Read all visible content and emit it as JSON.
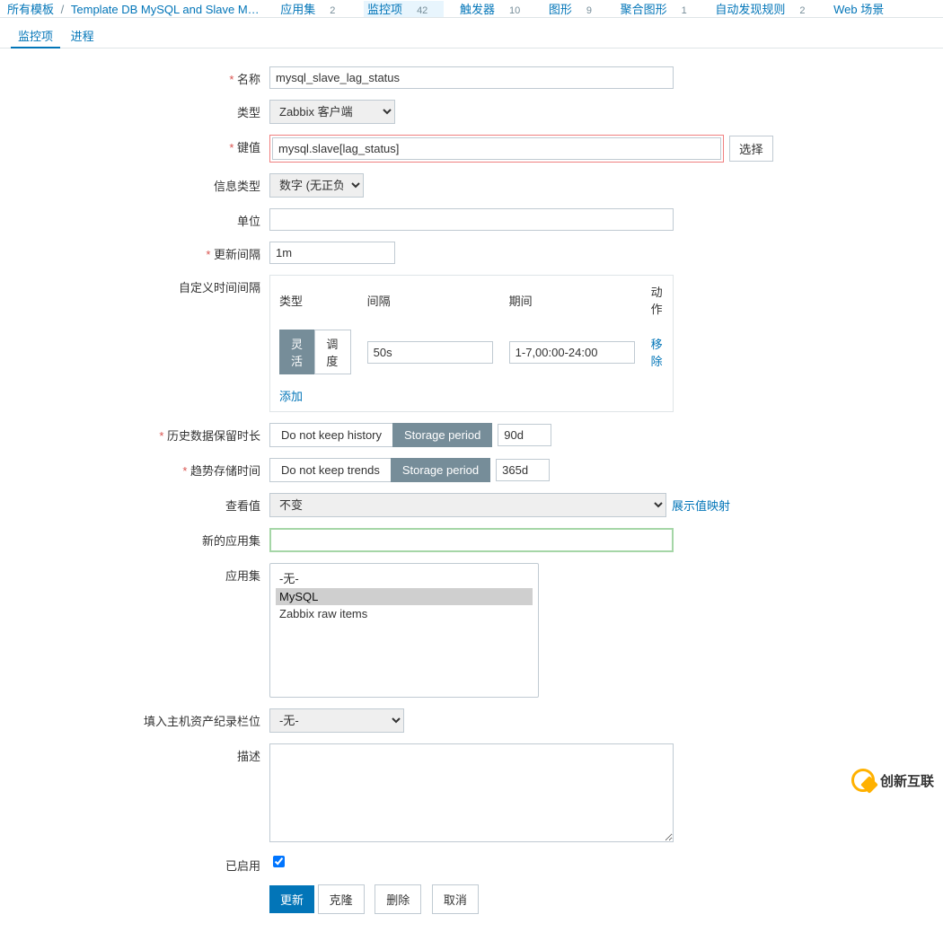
{
  "breadcrumb": {
    "all_templates": "所有模板",
    "template_name": "Template DB MySQL and Slave M…"
  },
  "topTabs": {
    "apps": {
      "label": "应用集",
      "count": "2"
    },
    "items": {
      "label": "监控项",
      "count": "42"
    },
    "triggers": {
      "label": "触发器",
      "count": "10"
    },
    "graphs": {
      "label": "图形",
      "count": "9"
    },
    "screens": {
      "label": "聚合图形",
      "count": "1"
    },
    "discovery": {
      "label": "自动发现规则",
      "count": "2"
    },
    "web": {
      "label": "Web 场景",
      "count": ""
    }
  },
  "subTabs": {
    "item": "监控项",
    "process": "进程"
  },
  "labels": {
    "name": "名称",
    "type": "类型",
    "key": "键值",
    "info_type": "信息类型",
    "units": "单位",
    "update": "更新间隔",
    "custom_int": "自定义时间间隔",
    "history": "历史数据保留时长",
    "trends": "趋势存储时间",
    "show_value": "查看值",
    "new_app": "新的应用集",
    "app_set": "应用集",
    "populate": "填入主机资产纪录栏位",
    "desc": "描述",
    "enabled": "已启用"
  },
  "intervalHdr": {
    "type": "类型",
    "interval": "间隔",
    "period": "期间",
    "action": "动作"
  },
  "intervalSeg": {
    "flex": "灵活",
    "sched": "调度"
  },
  "values": {
    "name": "mysql_slave_lag_status",
    "type": "Zabbix 客户端",
    "key": "mysql.slave[lag_status]",
    "info_type": "数字 (无正负)",
    "units": "",
    "update": "1m",
    "int_delay": "50s",
    "int_period": "1-7,00:00-24:00",
    "show_value": "不变",
    "new_app": "",
    "asset": "-无-",
    "desc": ""
  },
  "history": {
    "nokeep": "Do not keep history",
    "period": "Storage period",
    "value": "90d"
  },
  "trends": {
    "nokeep": "Do not keep trends",
    "period": "Storage period",
    "value": "365d"
  },
  "links": {
    "select": "选择",
    "remove": "移除",
    "add": "添加",
    "show_map": "展示值映射"
  },
  "appOptions": {
    "none": "-无-",
    "mysql": "MySQL",
    "raw": "Zabbix raw items"
  },
  "buttons": {
    "update": "更新",
    "clone": "克隆",
    "delete": "删除",
    "cancel": "取消"
  },
  "watermark": "创新互联"
}
